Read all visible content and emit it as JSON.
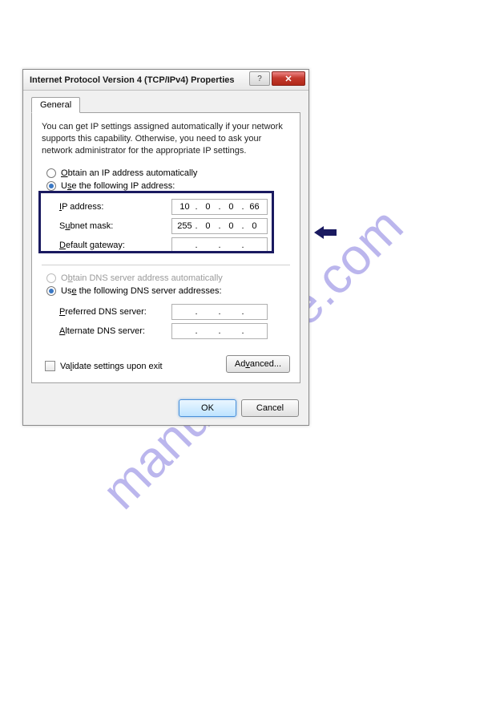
{
  "watermark": "manualshive.com",
  "dialog": {
    "title": "Internet Protocol Version 4 (TCP/IPv4) Properties",
    "tab": "General",
    "intro": "You can get IP settings assigned automatically if your network supports this capability. Otherwise, you need to ask your network administrator for the appropriate IP settings.",
    "radio_auto_ip": "Obtain an IP address automatically",
    "radio_manual_ip": "Use the following IP address:",
    "ip_label": "IP address:",
    "ip_value": [
      "10",
      "0",
      "0",
      "66"
    ],
    "subnet_label": "Subnet mask:",
    "subnet_value": [
      "255",
      "0",
      "0",
      "0"
    ],
    "gateway_label": "Default gateway:",
    "gateway_value": [
      "",
      "",
      "",
      ""
    ],
    "radio_auto_dns": "Obtain DNS server address automatically",
    "radio_manual_dns": "Use the following DNS server addresses:",
    "pref_dns_label": "Preferred DNS server:",
    "alt_dns_label": "Alternate DNS server:",
    "validate_label": "Validate settings upon exit",
    "advanced_label": "Advanced...",
    "ok_label": "OK",
    "cancel_label": "Cancel"
  }
}
